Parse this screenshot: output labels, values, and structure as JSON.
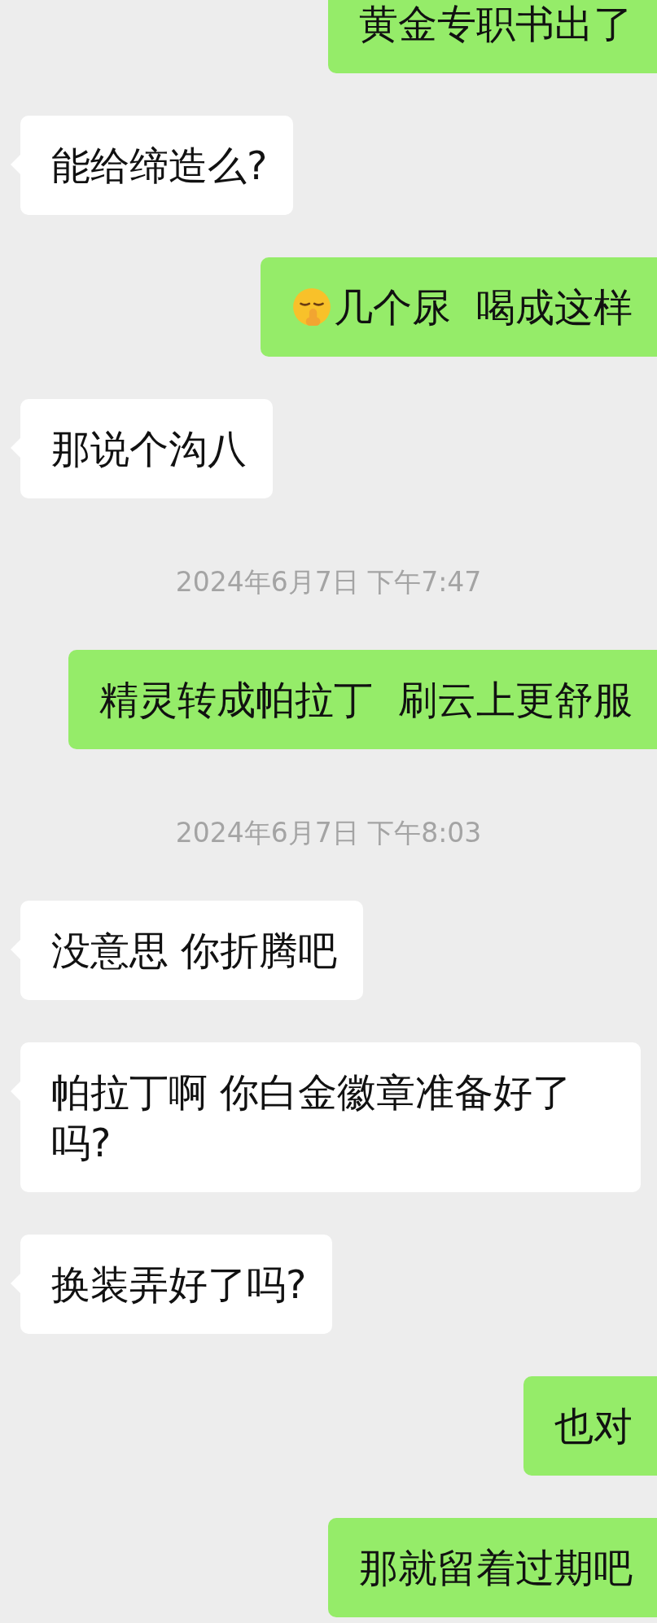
{
  "messages": [
    {
      "kind": "message",
      "outgoing": true,
      "text": "黄金专职书出了"
    },
    {
      "kind": "message",
      "outgoing": false,
      "text": "能给缔造么?"
    },
    {
      "kind": "message",
      "outgoing": true,
      "text": "几个尿  喝成这样",
      "has_emoji": true
    },
    {
      "kind": "message",
      "outgoing": false,
      "text": "那说个沟八"
    },
    {
      "kind": "timestamp",
      "text": "2024年6月7日 下午7:47"
    },
    {
      "kind": "message",
      "outgoing": true,
      "text": "精灵转成帕拉丁  刷云上更舒服"
    },
    {
      "kind": "timestamp",
      "text": "2024年6月7日 下午8:03"
    },
    {
      "kind": "message",
      "outgoing": false,
      "text": "没意思 你折腾吧"
    },
    {
      "kind": "message",
      "outgoing": false,
      "text": "帕拉丁啊 你白金徽章准备好了吗?"
    },
    {
      "kind": "message",
      "outgoing": false,
      "text": "换装弄好了吗?"
    },
    {
      "kind": "message",
      "outgoing": true,
      "text": "也对"
    },
    {
      "kind": "message",
      "outgoing": true,
      "text": "那就留着过期吧"
    }
  ]
}
